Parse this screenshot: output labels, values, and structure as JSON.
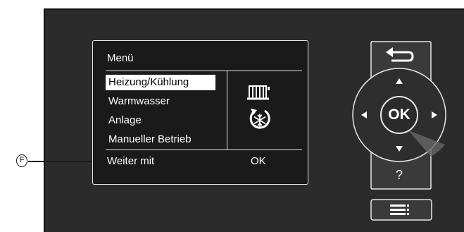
{
  "callout": {
    "label": "F"
  },
  "screen": {
    "title": "Menü",
    "items": [
      {
        "label": "Heizung/Kühlung",
        "selected": true
      },
      {
        "label": "Warmwasser",
        "selected": false
      },
      {
        "label": "Anlage",
        "selected": false
      },
      {
        "label": "Manueller Betrieb",
        "selected": false
      }
    ],
    "footer": {
      "left": "Weiter mit",
      "right": "OK"
    },
    "icons": [
      "radiator-icon",
      "snowflake-cycle-icon"
    ]
  },
  "controls": {
    "back_icon": "back-arrow-icon",
    "ok_label": "OK",
    "help_label": "?",
    "menu_icon": "menu-list-icon",
    "arrows": [
      "up-arrow-icon",
      "down-arrow-icon",
      "left-arrow-icon",
      "right-arrow-icon"
    ]
  },
  "colors": {
    "panel": "#2b2b2b",
    "screen": "#1a1a1a",
    "button_fill": "#3a3a3a",
    "button_border": "#e6e6e6",
    "text": "#ffffff"
  }
}
